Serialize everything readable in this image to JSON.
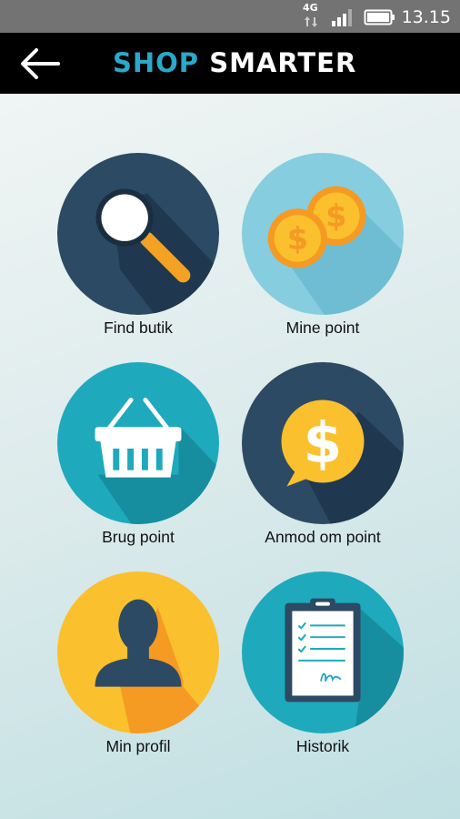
{
  "status_bar": {
    "network": "4G",
    "time": "13.15"
  },
  "app_bar": {
    "title_part1": "SHOP",
    "title_part2": "SMARTER"
  },
  "menu": [
    {
      "label": "Find butik",
      "icon": "magnifier-icon"
    },
    {
      "label": "Mine point",
      "icon": "coins-icon"
    },
    {
      "label": "Brug point",
      "icon": "basket-icon"
    },
    {
      "label": "Anmod om point",
      "icon": "dollar-speech-icon"
    },
    {
      "label": "Min profil",
      "icon": "user-silhouette-icon"
    },
    {
      "label": "Historik",
      "icon": "clipboard-icon"
    }
  ],
  "colors": {
    "dark_navy": "#2c4a63",
    "light_blue": "#86cde0",
    "teal": "#1fa9bd",
    "yellow": "#fbc02d",
    "orange": "#f59a23",
    "cyan_accent": "#2aa9c9"
  }
}
